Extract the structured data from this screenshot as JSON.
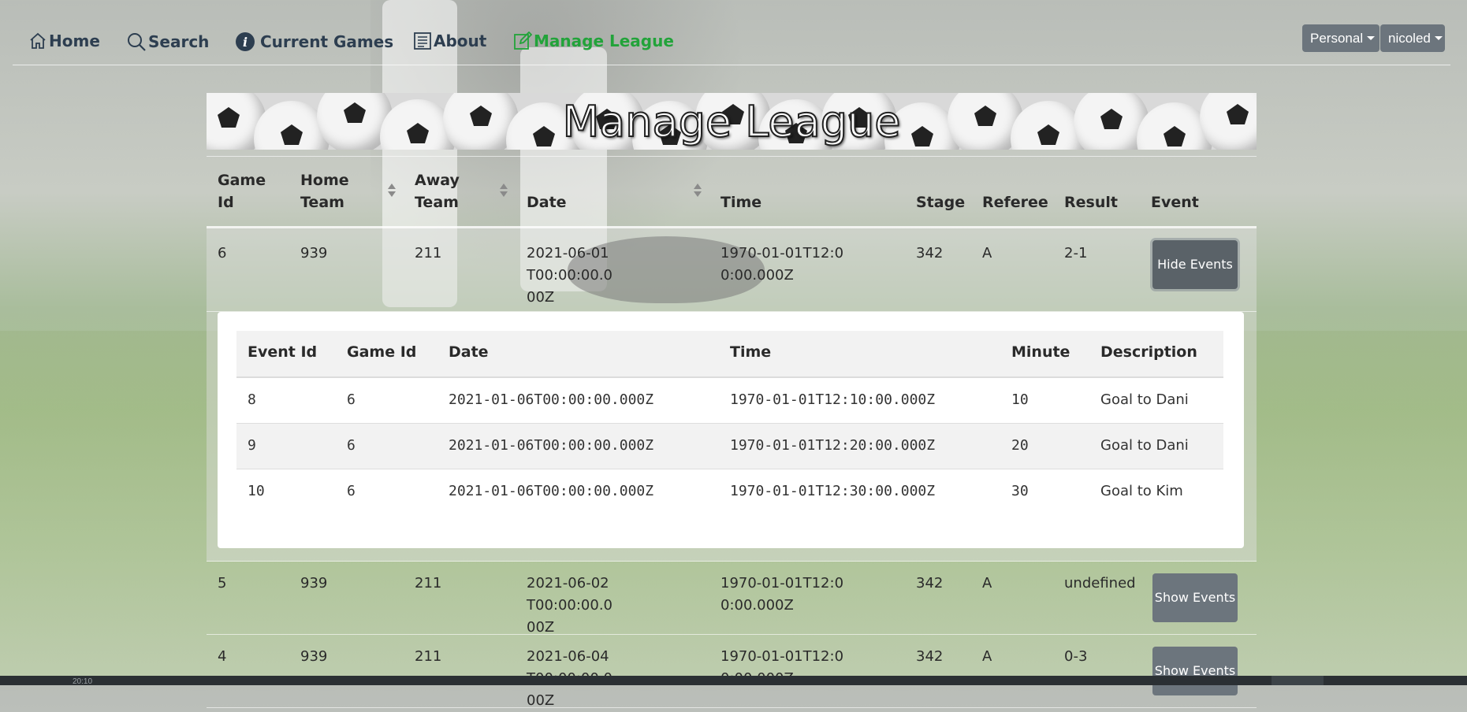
{
  "nav": {
    "home": "Home",
    "search": "Search",
    "current_games": "Current Games",
    "about": "About",
    "manage_league": "Manage League",
    "personal_dropdown": "Personal",
    "user_dropdown": "nicoled",
    "active_color": "#22a33a"
  },
  "banner": {
    "title": "Manage League"
  },
  "games_table": {
    "headers": {
      "game_id": "Game Id",
      "home_team": "Home Team",
      "away_team": "Away Team",
      "date": "Date",
      "time": "Time",
      "stage": "Stage",
      "referee": "Referee",
      "result": "Result",
      "event": "Event"
    },
    "rows": [
      {
        "game_id": "6",
        "home_team": "939",
        "away_team": "211",
        "date": "2021-06-01T00:00:00.000Z",
        "time": "1970-01-01T12:00:00.000Z",
        "stage": "342",
        "referee": "A",
        "result": "2-1",
        "button": "Hide Events"
      },
      {
        "game_id": "5",
        "home_team": "939",
        "away_team": "211",
        "date": "2021-06-02T00:00:00.000Z",
        "time": "1970-01-01T12:00:00.000Z",
        "stage": "342",
        "referee": "A",
        "result": "undefined",
        "button": "Show Events"
      },
      {
        "game_id": "4",
        "home_team": "939",
        "away_team": "211",
        "date": "2021-06-04T00:00:00.000Z",
        "time": "1970-01-01T12:00:00.000Z",
        "stage": "342",
        "referee": "A",
        "result": "0-3",
        "button": "Show Events"
      }
    ]
  },
  "events_table": {
    "headers": {
      "event_id": "Event Id",
      "game_id": "Game Id",
      "date": "Date",
      "time": "Time",
      "minute": "Minute",
      "description": "Description"
    },
    "rows": [
      {
        "event_id": "8",
        "game_id": "6",
        "date": "2021-01-06T00:00:00.000Z",
        "time": "1970-01-01T12:10:00.000Z",
        "minute": "10",
        "description": "Goal to Dani"
      },
      {
        "event_id": "9",
        "game_id": "6",
        "date": "2021-01-06T00:00:00.000Z",
        "time": "1970-01-01T12:20:00.000Z",
        "minute": "20",
        "description": "Goal to Dani"
      },
      {
        "event_id": "10",
        "game_id": "6",
        "date": "2021-01-06T00:00:00.000Z",
        "time": "1970-01-01T12:30:00.000Z",
        "minute": "30",
        "description": "Goal to Kim"
      }
    ]
  },
  "taskbar": {
    "clock": "20:10"
  }
}
